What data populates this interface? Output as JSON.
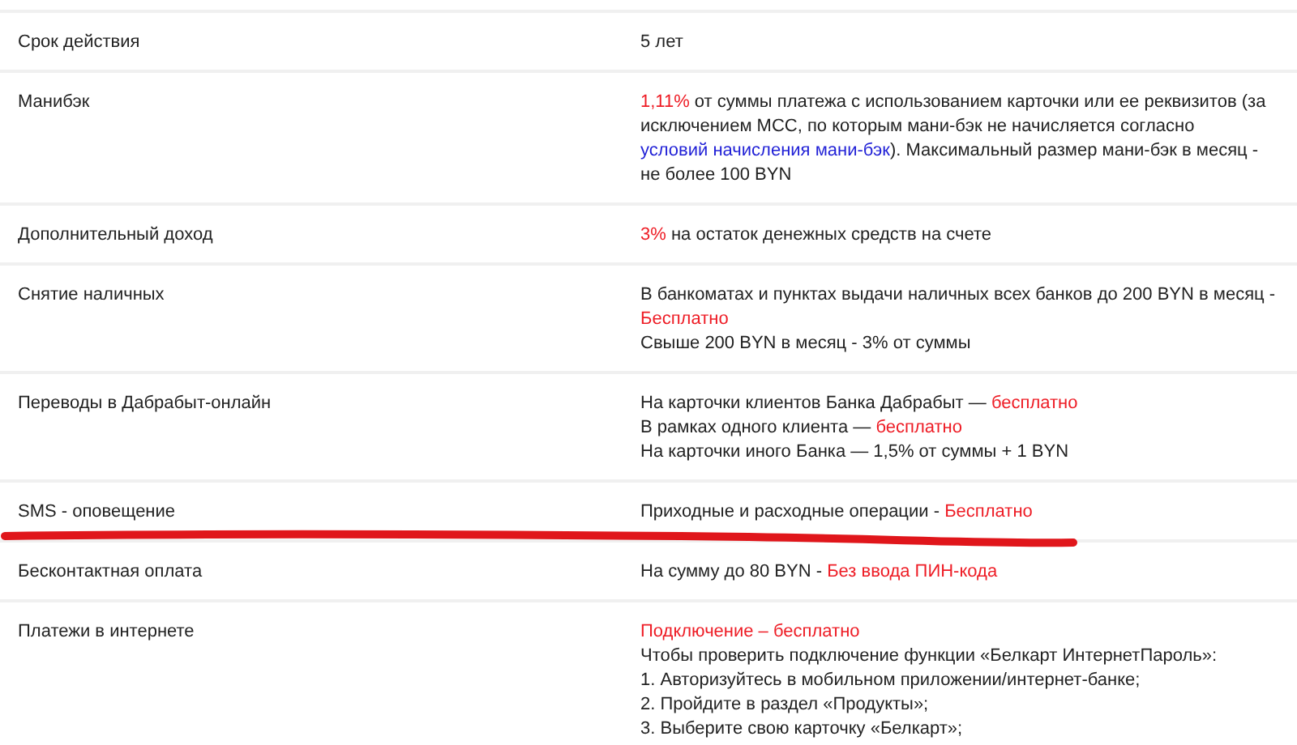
{
  "rows": [
    {
      "label": "Срок действия",
      "value": [
        [
          {
            "kind": "plain",
            "text": "5 лет"
          }
        ]
      ]
    },
    {
      "label": "Манибэк",
      "value": [
        [
          {
            "kind": "accent",
            "text": "1,11%"
          },
          {
            "kind": "plain",
            "text": " от суммы платежа с использованием карточки или ее реквизитов (за исключением МСС, по которым мани-бэк не начисляется согласно "
          },
          {
            "kind": "link",
            "text": "условий начисления мани-бэк"
          },
          {
            "kind": "plain",
            "text": "). Максимальный размер мани-бэк в месяц - не более 100 BYN"
          }
        ]
      ]
    },
    {
      "label": "Дополнительный доход",
      "value": [
        [
          {
            "kind": "accent",
            "text": "3%"
          },
          {
            "kind": "plain",
            "text": " на остаток денежных средств на счете"
          }
        ]
      ]
    },
    {
      "label": "Снятие наличных",
      "value": [
        [
          {
            "kind": "plain",
            "text": "В банкоматах и пунктах выдачи наличных всех банков до 200 BYN в месяц - "
          },
          {
            "kind": "accent",
            "text": "Бесплатно"
          }
        ],
        [
          {
            "kind": "plain",
            "text": "Свыше 200 BYN в месяц - 3% от суммы"
          }
        ]
      ]
    },
    {
      "label": "Переводы в Дабрабыт-онлайн",
      "value": [
        [
          {
            "kind": "plain",
            "text": "На карточки клиентов Банка Дабрабыт — "
          },
          {
            "kind": "accent",
            "text": "бесплатно"
          }
        ],
        [
          {
            "kind": "plain",
            "text": "В рамках одного клиента — "
          },
          {
            "kind": "accent",
            "text": "бесплатно"
          }
        ],
        [
          {
            "kind": "plain",
            "text": "На карточки иного Банка — 1,5% от суммы + 1 BYN"
          }
        ]
      ]
    },
    {
      "label": "SMS - оповещение",
      "value": [
        [
          {
            "kind": "plain",
            "text": "Приходные и расходные операции - "
          },
          {
            "kind": "accent",
            "text": "Бесплатно"
          }
        ]
      ]
    },
    {
      "label": "Бесконтактная оплата",
      "value": [
        [
          {
            "kind": "plain",
            "text": "На сумму до 80 BYN - "
          },
          {
            "kind": "accent",
            "text": "Без ввода ПИН-кода"
          }
        ]
      ]
    },
    {
      "label": "Платежи в интернете",
      "value": [
        [
          {
            "kind": "accent",
            "text": "Подключение – бесплатно"
          }
        ],
        [
          {
            "kind": "plain",
            "text": "Чтобы проверить подключение функции «Белкарт ИнтернетПароль»:"
          }
        ],
        [
          {
            "kind": "plain",
            "text": "1. Авторизуйтесь в мобильном приложении/интернет-банке;"
          }
        ],
        [
          {
            "kind": "plain",
            "text": "2. Пройдите в раздел «Продукты»;"
          }
        ],
        [
          {
            "kind": "plain",
            "text": "3. Выберите свою карточку «Белкарт»;"
          }
        ]
      ]
    }
  ]
}
